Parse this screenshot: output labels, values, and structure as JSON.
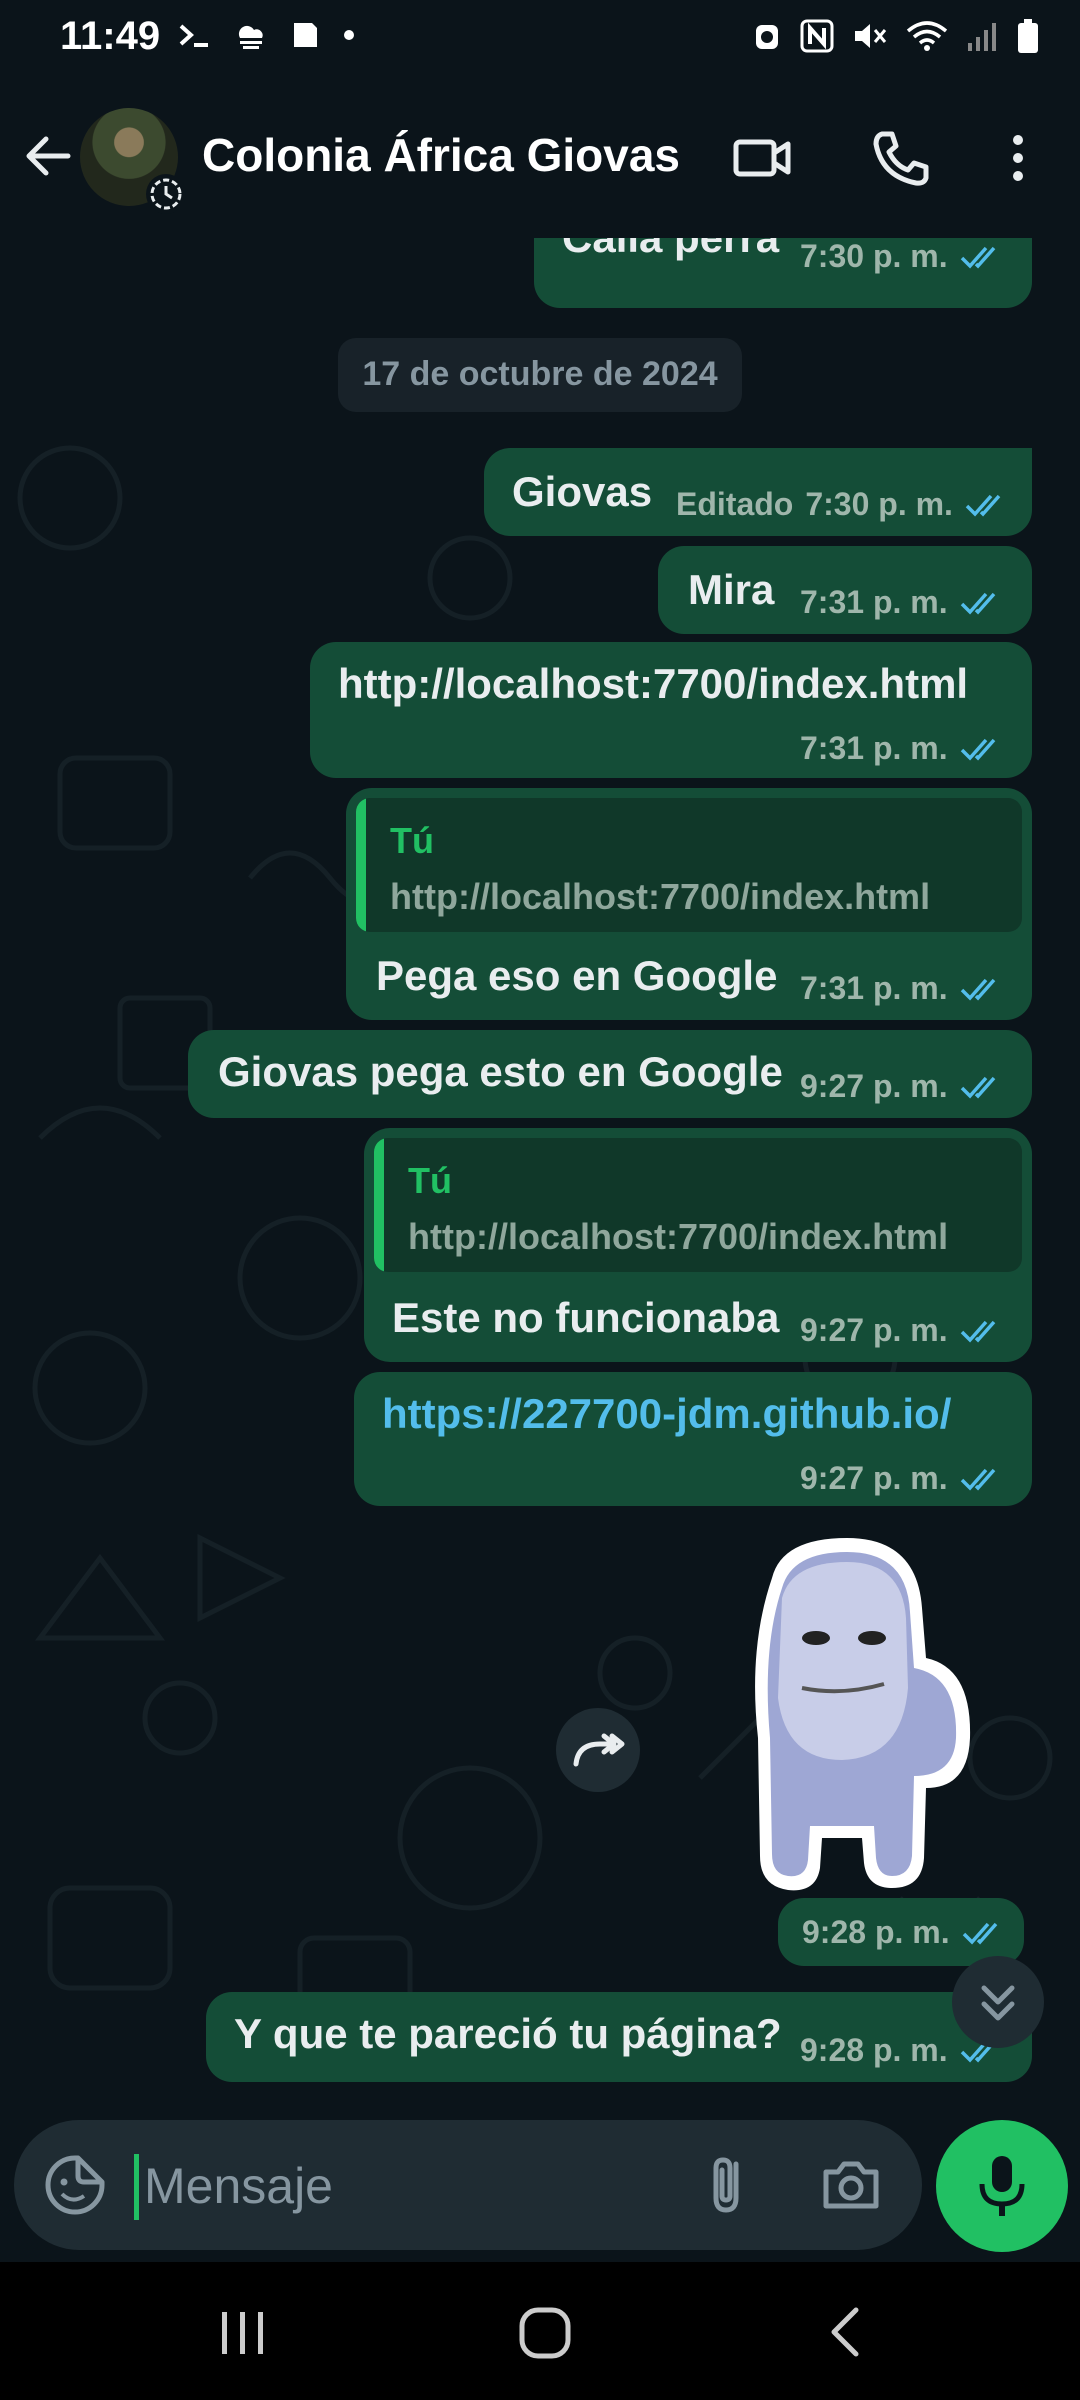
{
  "status_bar": {
    "time": "11:49",
    "left_icons": [
      "terminal-icon",
      "weather-icon",
      "gallery-icon",
      "dot-icon"
    ],
    "right_icons": [
      "alarm-icon",
      "nfc-icon",
      "mute-icon",
      "wifi-icon",
      "signal-icon",
      "battery-icon"
    ]
  },
  "header": {
    "title": "Colonia África Giovas",
    "icons": [
      "back-arrow-icon",
      "video-call-icon",
      "voice-call-icon",
      "more-menu-icon"
    ]
  },
  "date_separator": "17 de octubre de 2024",
  "messages": [
    {
      "text": "Calla perra",
      "edited": "",
      "time": "7:30 p. m."
    },
    {
      "text": "Giovas",
      "edited": "Editado",
      "time": "7:30 p. m."
    },
    {
      "text": "Mira",
      "edited": "",
      "time": "7:31 p. m."
    },
    {
      "text": "http://localhost:7700/index.html",
      "edited": "",
      "time": "7:31 p. m."
    },
    {
      "quote_author": "Tú",
      "quote_text": "http://localhost:7700/index.html",
      "text": "Pega eso en Google",
      "time": "7:31 p. m."
    },
    {
      "text": "Giovas pega esto en Google",
      "edited": "",
      "time": "9:27 p. m."
    },
    {
      "quote_author": "Tú",
      "quote_text": "http://localhost:7700/index.html",
      "text": "Este no funcionaba",
      "time": "9:27 p. m."
    },
    {
      "text": "https://227700-jdm.github.io/",
      "is_link": true,
      "time": "9:27 p. m."
    },
    {
      "sticker": "amogus-sticker",
      "time": "9:28 p. m."
    },
    {
      "text": "Y que te pareció tu página?",
      "time": "9:28 p. m."
    }
  ],
  "input": {
    "placeholder": "Mensaje",
    "value": ""
  },
  "colors": {
    "background": "#0b141a",
    "outgoing_bubble": "#144d37",
    "accent_green": "#21c063",
    "read_ticks": "#53bdeb",
    "link": "#53bdeb"
  }
}
